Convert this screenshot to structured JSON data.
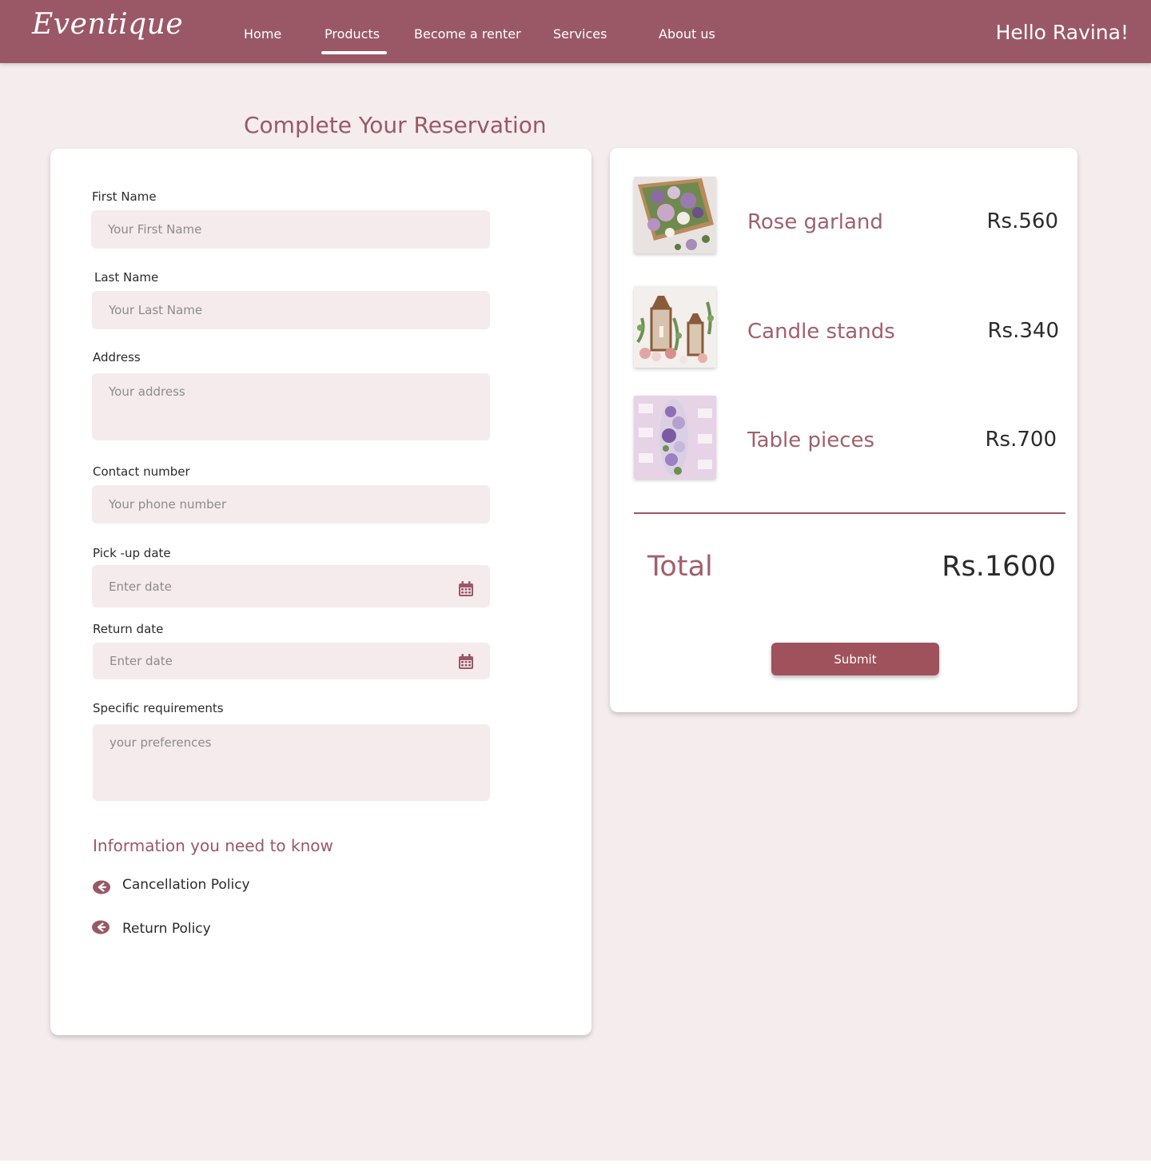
{
  "brand": {
    "logo_text": "Eventique"
  },
  "nav": {
    "links": [
      "Home",
      "Products",
      "Become a renter",
      "Services",
      "About us"
    ],
    "active": "Products",
    "greeting": "Hello Ravina!"
  },
  "page": {
    "title": "Complete Your Reservation"
  },
  "form": {
    "first_name": {
      "label": "First Name",
      "placeholder": "Your First Name"
    },
    "last_name": {
      "label": "Last Name",
      "placeholder": "Your Last Name"
    },
    "address": {
      "label": "Address",
      "placeholder": "Your address"
    },
    "contact": {
      "label": "Contact number",
      "placeholder": "Your phone number"
    },
    "pickup": {
      "label": "Pick -up date",
      "placeholder": "Enter date",
      "icon": "calendar-icon"
    },
    "return": {
      "label": "Return date",
      "placeholder": "Enter date",
      "icon": "calendar-icon"
    },
    "requirements": {
      "label": "Specific requirements",
      "placeholder": "your preferences"
    }
  },
  "info": {
    "title": "Information you need to know",
    "policies": [
      {
        "label": "Cancellation Policy",
        "icon": "arrow-left-circle-icon"
      },
      {
        "label": "Return Policy",
        "icon": "arrow-left-circle-icon"
      }
    ]
  },
  "summary": {
    "items": [
      {
        "name": "Rose garland",
        "price": "Rs.560",
        "image": "rose-garland-photo"
      },
      {
        "name": "Candle stands",
        "price": "Rs.340",
        "image": "candle-stands-photo"
      },
      {
        "name": "Table pieces",
        "price": "Rs.700",
        "image": "table-pieces-photo"
      }
    ],
    "total_label": "Total",
    "total_value": "Rs.1600",
    "submit_label": "Submit"
  },
  "colors": {
    "brand": "#9a5866",
    "background": "#f5eced",
    "field": "#f5eaec",
    "button": "#a0525c"
  }
}
